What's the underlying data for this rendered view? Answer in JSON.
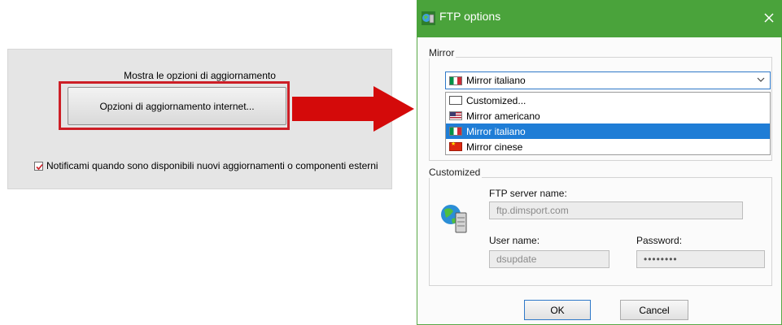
{
  "update_panel": {
    "heading": "Mostra le opzioni di aggiornamento",
    "button_label": "Opzioni di aggiornamento internet...",
    "notify_label": "Notificami quando sono disponibili nuovi aggiornamenti o componenti esterni",
    "notify_checked": true
  },
  "dialog": {
    "title": "FTP options",
    "mirror_group_label": "Mirror",
    "selected_mirror": "Mirror italiano",
    "mirror_options": [
      {
        "label": "Customized...",
        "flag": "blank-flag-icon"
      },
      {
        "label": "Mirror americano",
        "flag": "us-flag-icon"
      },
      {
        "label": "Mirror italiano",
        "flag": "italy-flag-icon",
        "selected": true
      },
      {
        "label": "Mirror cinese",
        "flag": "china-flag-icon"
      }
    ],
    "customized_group_label": "Customized",
    "server_label": "FTP server name:",
    "server_value": "ftp.dimsport.com",
    "user_label": "User name:",
    "user_value": "dsupdate",
    "password_label": "Password:",
    "password_value": "••••••••",
    "ok_label": "OK",
    "cancel_label": "Cancel"
  },
  "colors": {
    "titlebar": "#4aa33b",
    "highlight": "#cd1e26",
    "selection": "#1f7dd6"
  }
}
